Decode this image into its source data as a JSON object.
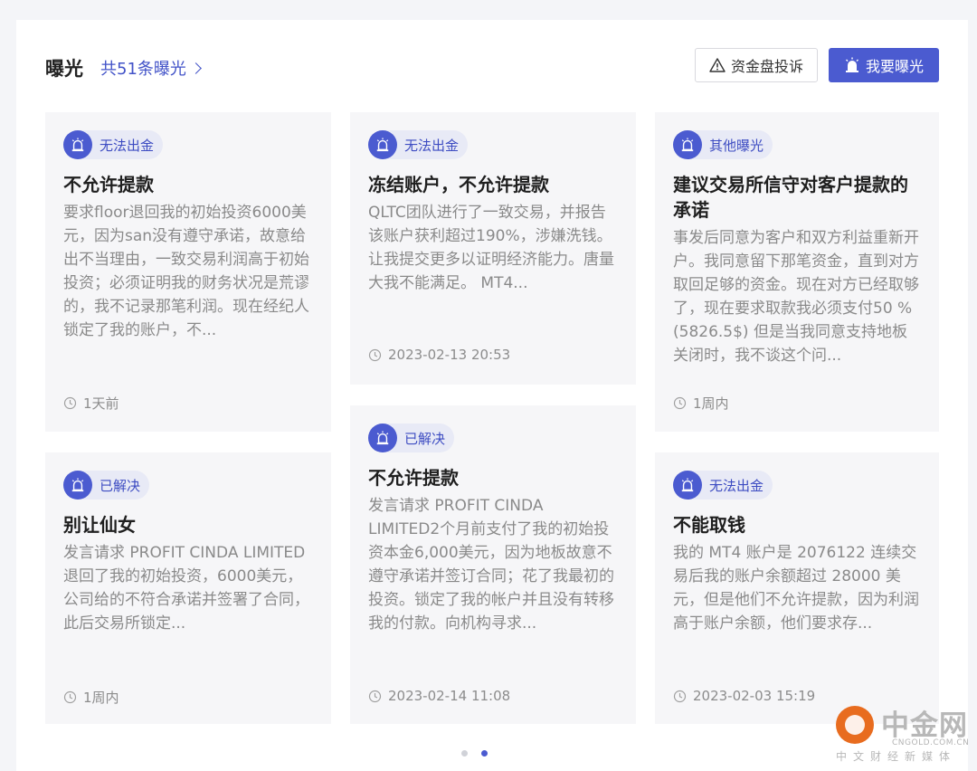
{
  "header": {
    "title": "曝光",
    "count_link": "共51条曝光",
    "complain_button": "资金盘投诉",
    "expose_button": "我要曝光"
  },
  "cards": [
    {
      "tag": "无法出金",
      "title": "不允许提款",
      "desc": "要求floor退回我的初始投资6000美元，因为san没有遵守承诺，故意给出不当理由，一致交易利润高于初始投资；必须证明我的财务状况是荒谬的，我不记录那笔利润。现在经纪人锁定了我的账户，不...",
      "time": "1天前"
    },
    {
      "tag": "无法出金",
      "title": "冻结账户，不允许提款",
      "desc": "QLTC团队进行了一致交易，并报告该账户获利超过190%，涉嫌洗钱。让我提交更多以证明经济能力。唐量大我不能满足。 MT4...",
      "time": "2023-02-13 20:53"
    },
    {
      "tag": "其他曝光",
      "title": "建议交易所信守对客户提款的承诺",
      "desc": "事发后同意为客户和双方利益重新开户。我同意留下那笔资金，直到对方取回足够的资金。现在对方已经取够了，现在要求取款我必须支付50 % (5826.5$) 但是当我同意支持地板关闭时，我不谈这个问...",
      "time": "1周内"
    },
    {
      "tag": "已解决",
      "title": "别让仙女",
      "desc": "发言请求 PROFIT CINDA LIMITED退回了我的初始投资，6000美元，公司给的不符合承诺并签署了合同，此后交易所锁定...",
      "time": "1周内"
    },
    {
      "tag": "已解决",
      "title": "不允许提款",
      "desc": "发言请求 PROFIT CINDA LIMITED2个月前支付了我的初始投资本金6,000美元，因为地板故意不遵守承诺并签订合同；花了我最初的投资。锁定了我的帐户并且没有转移我的付款。向机构寻求...",
      "time": "2023-02-14 11:08"
    },
    {
      "tag": "无法出金",
      "title": "不能取钱",
      "desc": "我的 MT4 账户是 2076122 连续交易后我的账户余额超过 28000 美元，但是他们不允许提款，因为利润高于账户余额，他们要求存...",
      "time": "2023-02-03 15:19"
    }
  ],
  "pagination": {
    "total": 2,
    "active": 2
  },
  "watermark": {
    "name": "中金网",
    "domain": "CNGOLD.COM.CN",
    "slogan": "中文财经新媒体"
  },
  "colors": {
    "accent": "#4b5bd0",
    "tag_bg": "#e8eaf6",
    "card_bg": "#f6f6f8",
    "text_muted": "#8a8a8a"
  }
}
